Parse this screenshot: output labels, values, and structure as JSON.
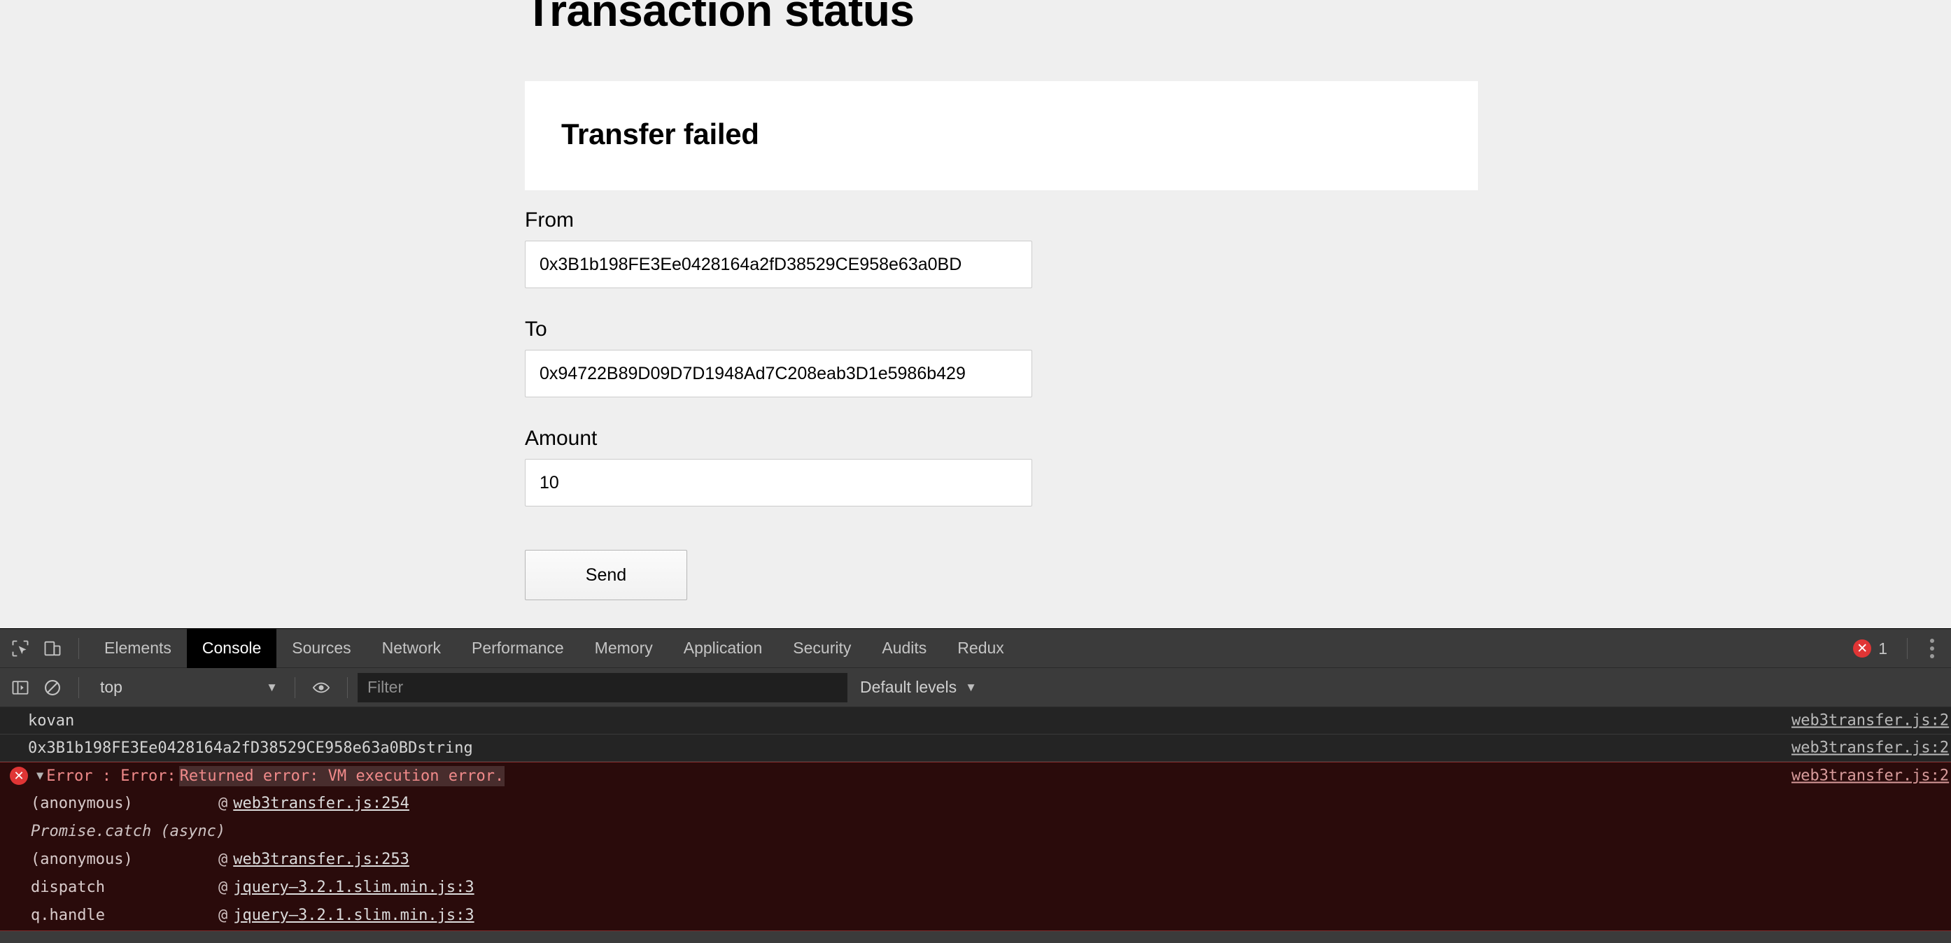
{
  "page": {
    "title": "Transaction status",
    "status_card": {
      "title": "Transfer failed"
    },
    "form": {
      "from": {
        "label": "From",
        "value": "0x3B1b198FE3Ee0428164a2fD38529CE958e63a0BD",
        "placeholder": ""
      },
      "to": {
        "label": "To",
        "value": "0x94722B89D09D7D1948Ad7C208eab3D1e5986b429",
        "placeholder": ""
      },
      "amount": {
        "label": "Amount",
        "value": "10",
        "placeholder": ""
      },
      "send_label": "Send"
    }
  },
  "devtools": {
    "icons": {
      "inspect": "inspect-element-icon",
      "device": "device-toolbar-icon",
      "sidebar": "console-sidebar-icon",
      "clear": "clear-console-icon",
      "eye": "live-expression-icon",
      "kebab": "more-options-icon"
    },
    "tabs": [
      {
        "label": "Elements",
        "active": false
      },
      {
        "label": "Console",
        "active": true
      },
      {
        "label": "Sources",
        "active": false
      },
      {
        "label": "Network",
        "active": false
      },
      {
        "label": "Performance",
        "active": false
      },
      {
        "label": "Memory",
        "active": false
      },
      {
        "label": "Application",
        "active": false
      },
      {
        "label": "Security",
        "active": false
      },
      {
        "label": "Audits",
        "active": false
      },
      {
        "label": "Redux",
        "active": false
      }
    ],
    "error_count": "1",
    "filterbar": {
      "context": "top",
      "filter_placeholder": "Filter",
      "filter_value": "",
      "levels": "Default levels"
    },
    "console": {
      "logs": [
        {
          "type": "log",
          "message": "kovan",
          "source": "web3transfer.js:2"
        },
        {
          "type": "log",
          "message": "0x3B1b198FE3Ee0428164a2fD38529CE958e63a0BDstring",
          "source": "web3transfer.js:2"
        }
      ],
      "error": {
        "prefix": "Error : Error:",
        "highlight": "Returned error: VM execution error.",
        "source": "web3transfer.js:2",
        "triangle": "▼",
        "stack": [
          {
            "fn": "(anonymous)",
            "at": "@",
            "link": "web3transfer.js:254",
            "async": false
          },
          {
            "fn": "Promise.catch (async)",
            "at": "",
            "link": "",
            "async": true
          },
          {
            "fn": "(anonymous)",
            "at": "@",
            "link": "web3transfer.js:253",
            "async": false
          },
          {
            "fn": "dispatch",
            "at": "@",
            "link": "jquery–3.2.1.slim.min.js:3",
            "async": false
          },
          {
            "fn": "q.handle",
            "at": "@",
            "link": "jquery–3.2.1.slim.min.js:3",
            "async": false
          }
        ]
      }
    }
  },
  "colors": {
    "page_bg": "#efefef",
    "card_bg": "#ffffff",
    "devtools_bg": "#242424",
    "devtools_bar": "#3b3b3b",
    "error_red": "#e03535",
    "error_row_bg": "#2a0b0b"
  }
}
